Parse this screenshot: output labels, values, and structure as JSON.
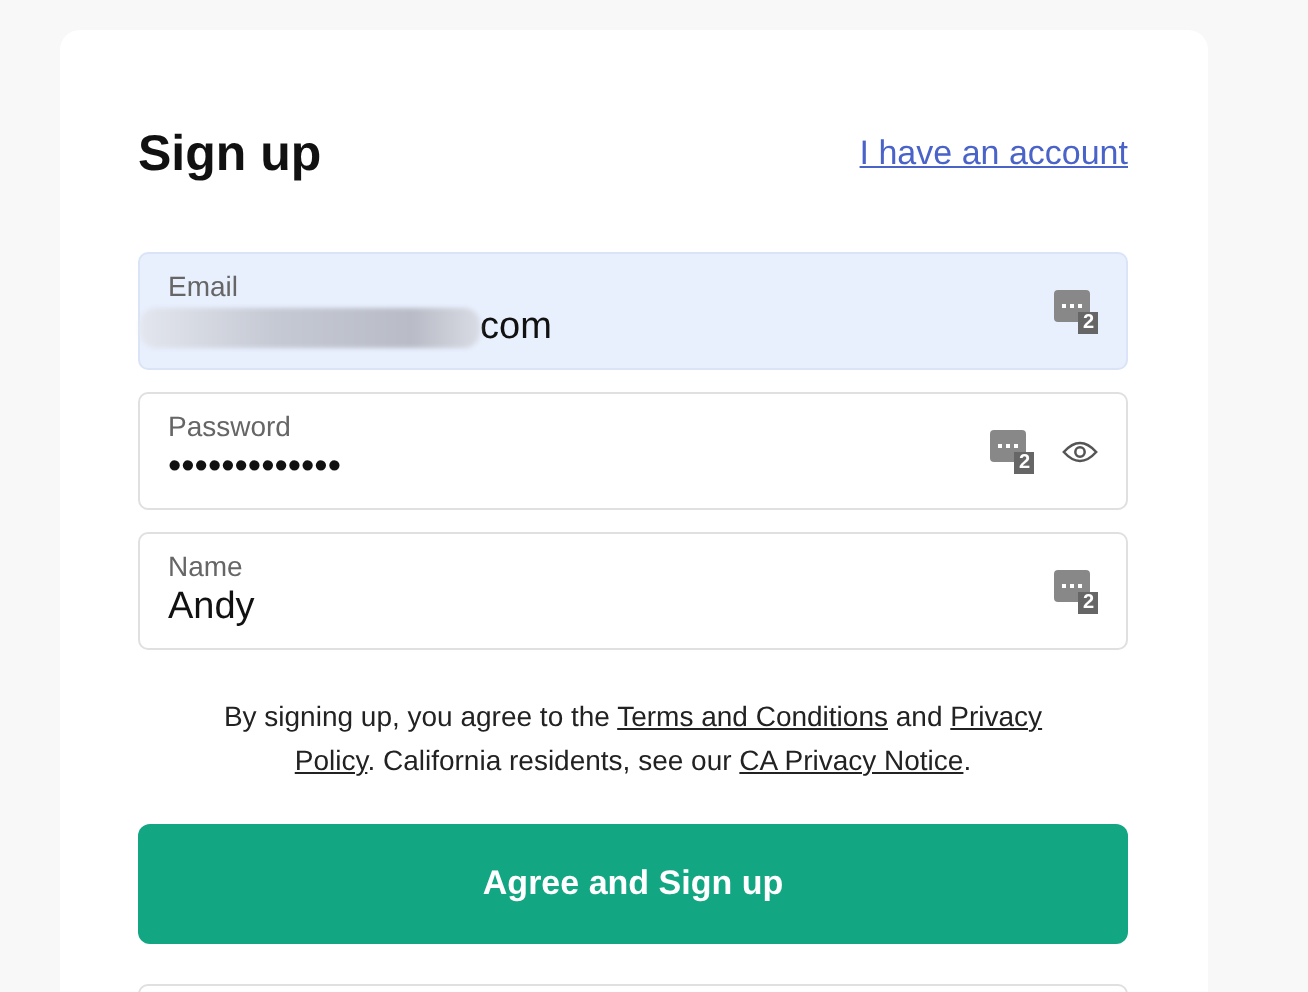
{
  "title": "Sign up",
  "account_link": "I have an account",
  "fields": [
    {
      "label": "Email",
      "value": "com",
      "redacted": true,
      "highlighted": true,
      "badge": "2",
      "reveal_toggle": false
    },
    {
      "label": "Password",
      "value": "•••••••••••••",
      "redacted": false,
      "highlighted": false,
      "badge": "2",
      "reveal_toggle": true
    },
    {
      "label": "Name",
      "value": "Andy",
      "redacted": false,
      "highlighted": false,
      "badge": "2",
      "reveal_toggle": false
    }
  ],
  "agreement": [
    {
      "kind": "text",
      "text": "By signing up, you agree to the "
    },
    {
      "kind": "link",
      "text": "Terms and Conditions"
    },
    {
      "kind": "text",
      "text": " and "
    },
    {
      "kind": "link",
      "text": "Privacy"
    },
    {
      "kind": "break"
    },
    {
      "kind": "link",
      "text": "Policy"
    },
    {
      "kind": "text",
      "text": ". California residents, see our "
    },
    {
      "kind": "link",
      "text": "CA Privacy Notice"
    },
    {
      "kind": "text",
      "text": "."
    }
  ],
  "submit": "Agree and Sign up"
}
